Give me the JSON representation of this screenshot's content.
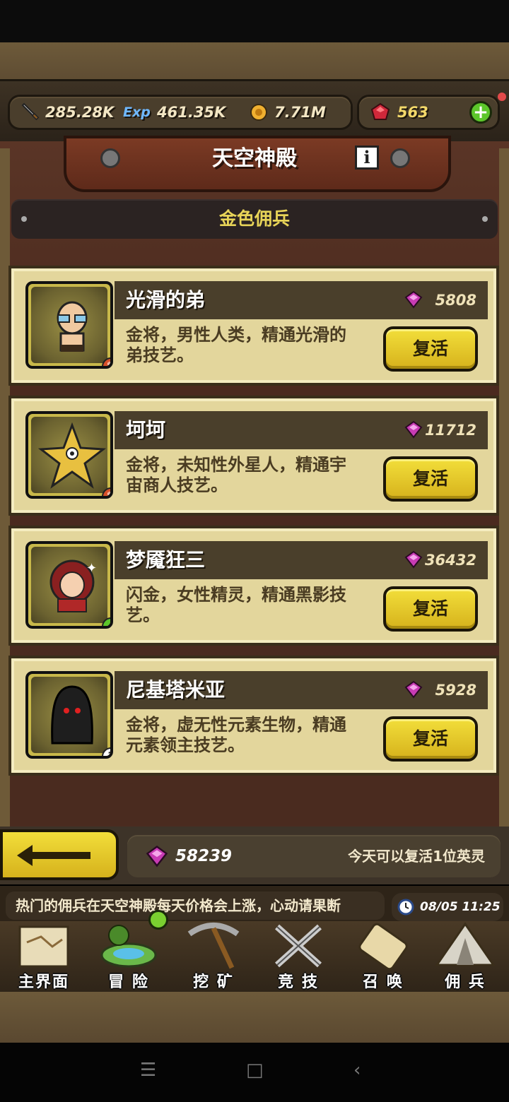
{
  "resources": {
    "attack": "285.28K",
    "exp_label": "Exp",
    "exp": "461.35K",
    "gold": "7.71M",
    "rubies": "563"
  },
  "title": "天空神殿",
  "info_label": "i",
  "category": "金色佣兵",
  "heroes": [
    {
      "name": "光滑的弟",
      "price": "5808",
      "desc": "金将，男性人类，精通光滑的弟技艺。",
      "revive": "复活",
      "portrait": "bald-man-goggles",
      "badge": "fire"
    },
    {
      "name": "坷坷",
      "price": "11712",
      "desc": "金将，未知性外星人，精通宇宙商人技艺。",
      "revive": "复活",
      "portrait": "golden-star-alien",
      "badge": "fire"
    },
    {
      "name": "梦魇狂三",
      "price": "36432",
      "desc": "闪金，女性精灵，精通黑影技艺。",
      "revive": "复活",
      "portrait": "red-haired-girl",
      "badge": "+"
    },
    {
      "name": "尼基塔米亚",
      "price": "5928",
      "desc": "金将，虚无性元素生物，精通元素领主技艺。",
      "revive": "复活",
      "portrait": "shadow-hooded",
      "badge": "?"
    }
  ],
  "footer": {
    "total_gems": "58239",
    "revive_info": "今天可以复活1位英灵"
  },
  "ticker": "热门的佣兵在天空神殿每天价格会上涨，心动请果断",
  "clock": "08/05 11:25",
  "nav": [
    "主界面",
    "冒 险",
    "挖 矿",
    "竞 技",
    "召 唤",
    "佣 兵"
  ],
  "colors": {
    "gold": "#e8d458",
    "panel": "#4a2b1f",
    "card": "#e3d69c",
    "gem": "#c83bb4"
  }
}
